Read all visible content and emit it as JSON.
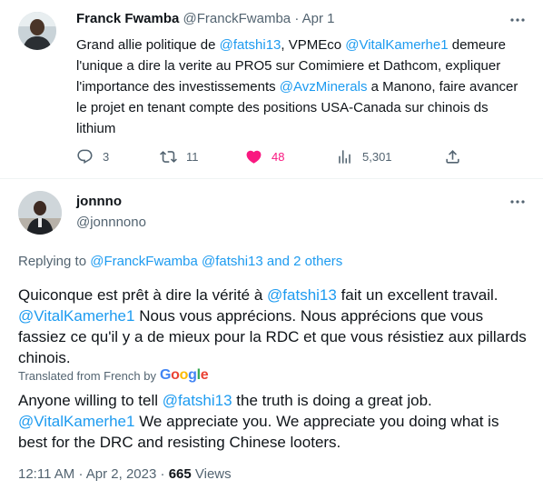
{
  "tweet": {
    "author_name": "Franck Fwamba",
    "author_handle": "@FranckFwamba",
    "date": "Apr 1",
    "text_parts": {
      "p1": "Grand allie politique de ",
      "m1": "@fatshi13",
      "p2": ", VPMEco ",
      "m2": "@VitalKamerhe1",
      "p3": " demeure l'unique a dire la verite au PRO5 sur Comimiere et Dathcom, expliquer l'importance des investissements ",
      "m3": "@AvzMinerals",
      "p4": " a Manono, faire avancer le projet en tenant compte des positions USA-Canada sur chinois ds lithium"
    },
    "stats": {
      "replies": "3",
      "retweets": "11",
      "likes": "48",
      "views": "5,301"
    }
  },
  "reply": {
    "author_name": "jonnno",
    "author_handle": "@jonnnono",
    "replying_prefix": "Replying to ",
    "replying_to": "@FranckFwamba @fatshi13 and 2 others",
    "original_parts": {
      "p1": "Quiconque est prêt à dire la vérité à ",
      "m1": "@fatshi13",
      "p2": " fait un excellent travail. ",
      "m2": "@VitalKamerhe1",
      "p3": " Nous vous apprécions. Nous apprécions que vous fassiez ce qu'il y a de mieux pour la RDC et que vous résistiez aux pillards chinois."
    },
    "translated_label": "Translated from French by",
    "translator_logo": {
      "G": "G",
      "o1": "o",
      "o2": "o",
      "g": "g",
      "l": "l",
      "e": "e"
    },
    "translation_parts": {
      "p1": "Anyone willing to tell ",
      "m1": "@fatshi13",
      "p2": " the truth is doing a great job. ",
      "m2": "@VitalKamerhe1",
      "p3": " We appreciate you. We appreciate you doing what is best for the DRC and resisting Chinese looters."
    },
    "time": "12:11 AM",
    "date": "Apr 2, 2023",
    "separator": "·",
    "views_count": "665",
    "views_label": "Views"
  },
  "colors": {
    "link": "#1d9bf0",
    "like": "#f91880",
    "muted": "#536471",
    "text": "#0f1419"
  },
  "icons": [
    "more-icon",
    "reply-icon",
    "retweet-icon",
    "like-icon",
    "views-icon",
    "share-icon"
  ]
}
